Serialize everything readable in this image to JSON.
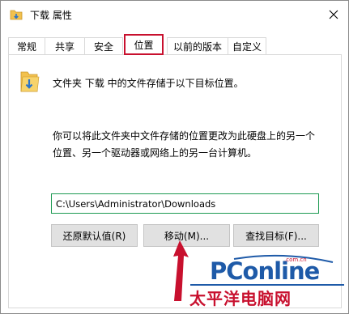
{
  "window": {
    "title": "下载 属性",
    "close_symbol": "✕"
  },
  "tabs": [
    {
      "label": "常规",
      "active": false
    },
    {
      "label": "共享",
      "active": false
    },
    {
      "label": "安全",
      "active": false
    },
    {
      "label": "位置",
      "active": true
    },
    {
      "label": "以前的版本",
      "active": false
    },
    {
      "label": "自定义",
      "active": false
    }
  ],
  "location": {
    "info": "文件夹 下载 中的文件存储于以下目标位置。",
    "description_line1": "你可以将此文件夹中文件存储的位置更改为此硬盘上的另一个",
    "description_line2": "位置、另一个驱动器或网络上的另一台计算机。",
    "path_value": "C:\\Users\\Administrator\\Downloads"
  },
  "buttons": {
    "restore_default": "还原默认值(R)",
    "move": "移动(M)...",
    "find_target": "查找目标(F)..."
  },
  "watermark": {
    "brand": "PConline",
    "domain": ".com.cn",
    "cn_name": "太平洋电脑网"
  },
  "colors": {
    "highlight": "#c8102e",
    "input_border": "#1d9a52",
    "brand_blue": "#1e5aa8",
    "folder_yellow": "#f2c14e"
  },
  "icons": {
    "title": "folder-download-icon",
    "close": "close-icon",
    "folder": "folder-download-icon",
    "arrow": "red-arrow-annotation"
  }
}
